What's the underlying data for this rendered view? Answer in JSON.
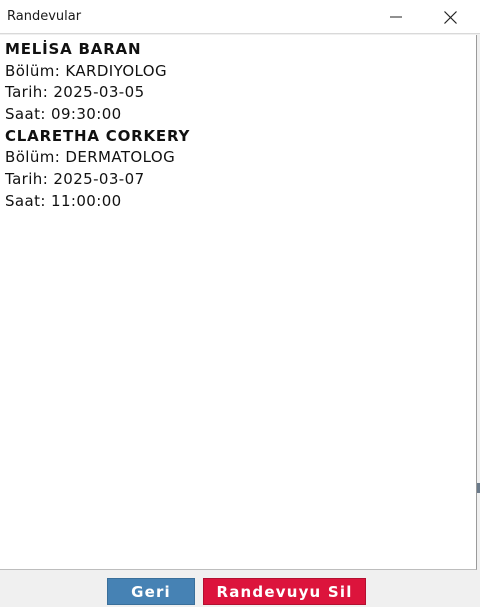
{
  "window": {
    "title": "Randevular"
  },
  "appointments": [
    {
      "name": "MELİSA BARAN",
      "department": "Bölüm: KARDIYOLOG",
      "date": "Tarih: 2025-03-05",
      "time": "Saat: 09:30:00"
    },
    {
      "name": "CLARETHA CORKERY",
      "department": "Bölüm: DERMATOLOG",
      "date": "Tarih: 2025-03-07",
      "time": "Saat: 11:00:00"
    }
  ],
  "buttons": {
    "back_label": "Geri",
    "delete_label": "Randevuyu Sil"
  },
  "colors": {
    "back_button": "#4682b4",
    "delete_button": "#dc143c"
  },
  "icons": {
    "minimize": "minimize-icon",
    "close": "close-icon"
  }
}
